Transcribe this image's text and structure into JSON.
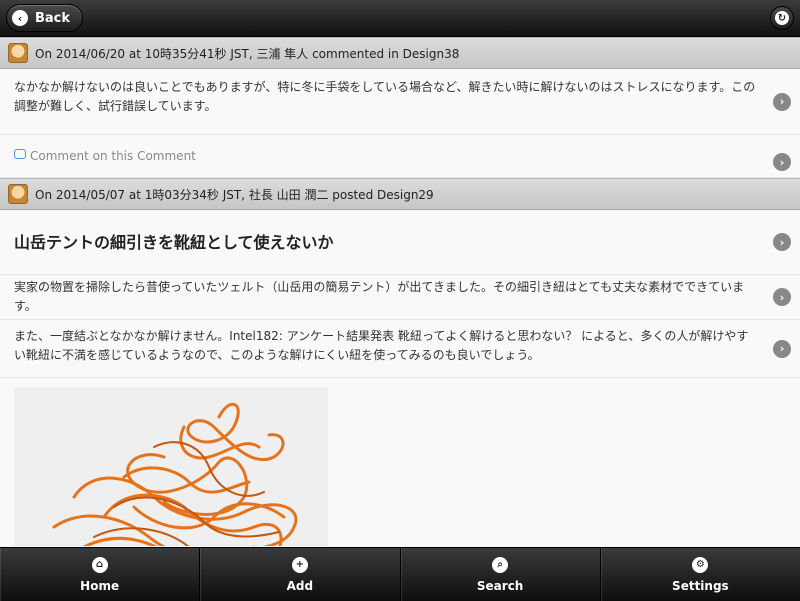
{
  "header": {
    "back_label": "Back",
    "back_icon": "‹",
    "refresh_icon": "↻"
  },
  "activity1": {
    "header": "On 2014/06/20 at 10時35分41秒 JST, 三浦 隼人 commented in Design38",
    "comment": "なかなか解けないのは良いことでもありますが、特に冬に手袋をしている場合など、解きたい時に解けないのはストレスになります。この調整が難しく、試行錯誤しています。",
    "comment_link": "Comment on this Comment"
  },
  "activity2": {
    "header": "On 2014/05/07 at 1時03分34秒 JST, 社長 山田 潤二 posted Design29",
    "title": "山岳テントの細引きを靴紐として使えないか",
    "paragraph1": "実家の物置を掃除したら昔使っていたツェルト（山岳用の簡易テント）が出てきました。その細引き紐はとても丈夫な素材でできています。",
    "paragraph2": "また、一度結ぶとなかなか解けません。Intel182: アンケート結果発表 靴紐ってよく解けると思わない？ によると、多くの人が解けやすい靴紐に不満を感じているようなので、このような解けにくい紐を使ってみるのも良いでしょう。"
  },
  "tabs": {
    "home": {
      "label": "Home",
      "icon": "⌂"
    },
    "add": {
      "label": "Add",
      "icon": "+"
    },
    "search": {
      "label": "Search",
      "icon": "⌕"
    },
    "settings": {
      "label": "Settings",
      "icon": "⚙"
    }
  }
}
